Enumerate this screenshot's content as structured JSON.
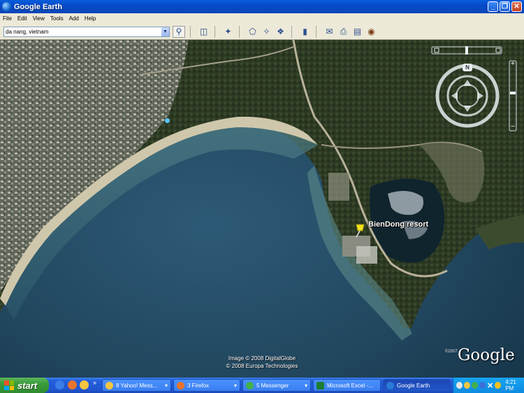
{
  "window": {
    "title": "Google Earth",
    "buttons": [
      "_",
      "❐",
      "✕"
    ]
  },
  "menu": [
    "File",
    "Edit",
    "View",
    "Tools",
    "Add",
    "Help"
  ],
  "search": {
    "value": "da nang, vietnam"
  },
  "map": {
    "placemark_label": "BienDong resort",
    "copyright_1": "Image © 2008 DigitalGlobe",
    "copyright_2": "© 2008 Europa Technologies",
    "logo": "Google",
    "logo_year": "©2007",
    "compass_north": "N"
  },
  "taskbar": {
    "start_label": "start",
    "tasks": [
      {
        "label": "8 Yahoo! Mess...",
        "arrow": "▾"
      },
      {
        "label": "3 Firefox",
        "arrow": "▾"
      },
      {
        "label": "5 Messenger",
        "arrow": "▾"
      },
      {
        "label": "Microsoft Excel -...",
        "arrow": ""
      },
      {
        "label": "Google Earth",
        "arrow": ""
      }
    ],
    "time": "4:21 PM"
  }
}
